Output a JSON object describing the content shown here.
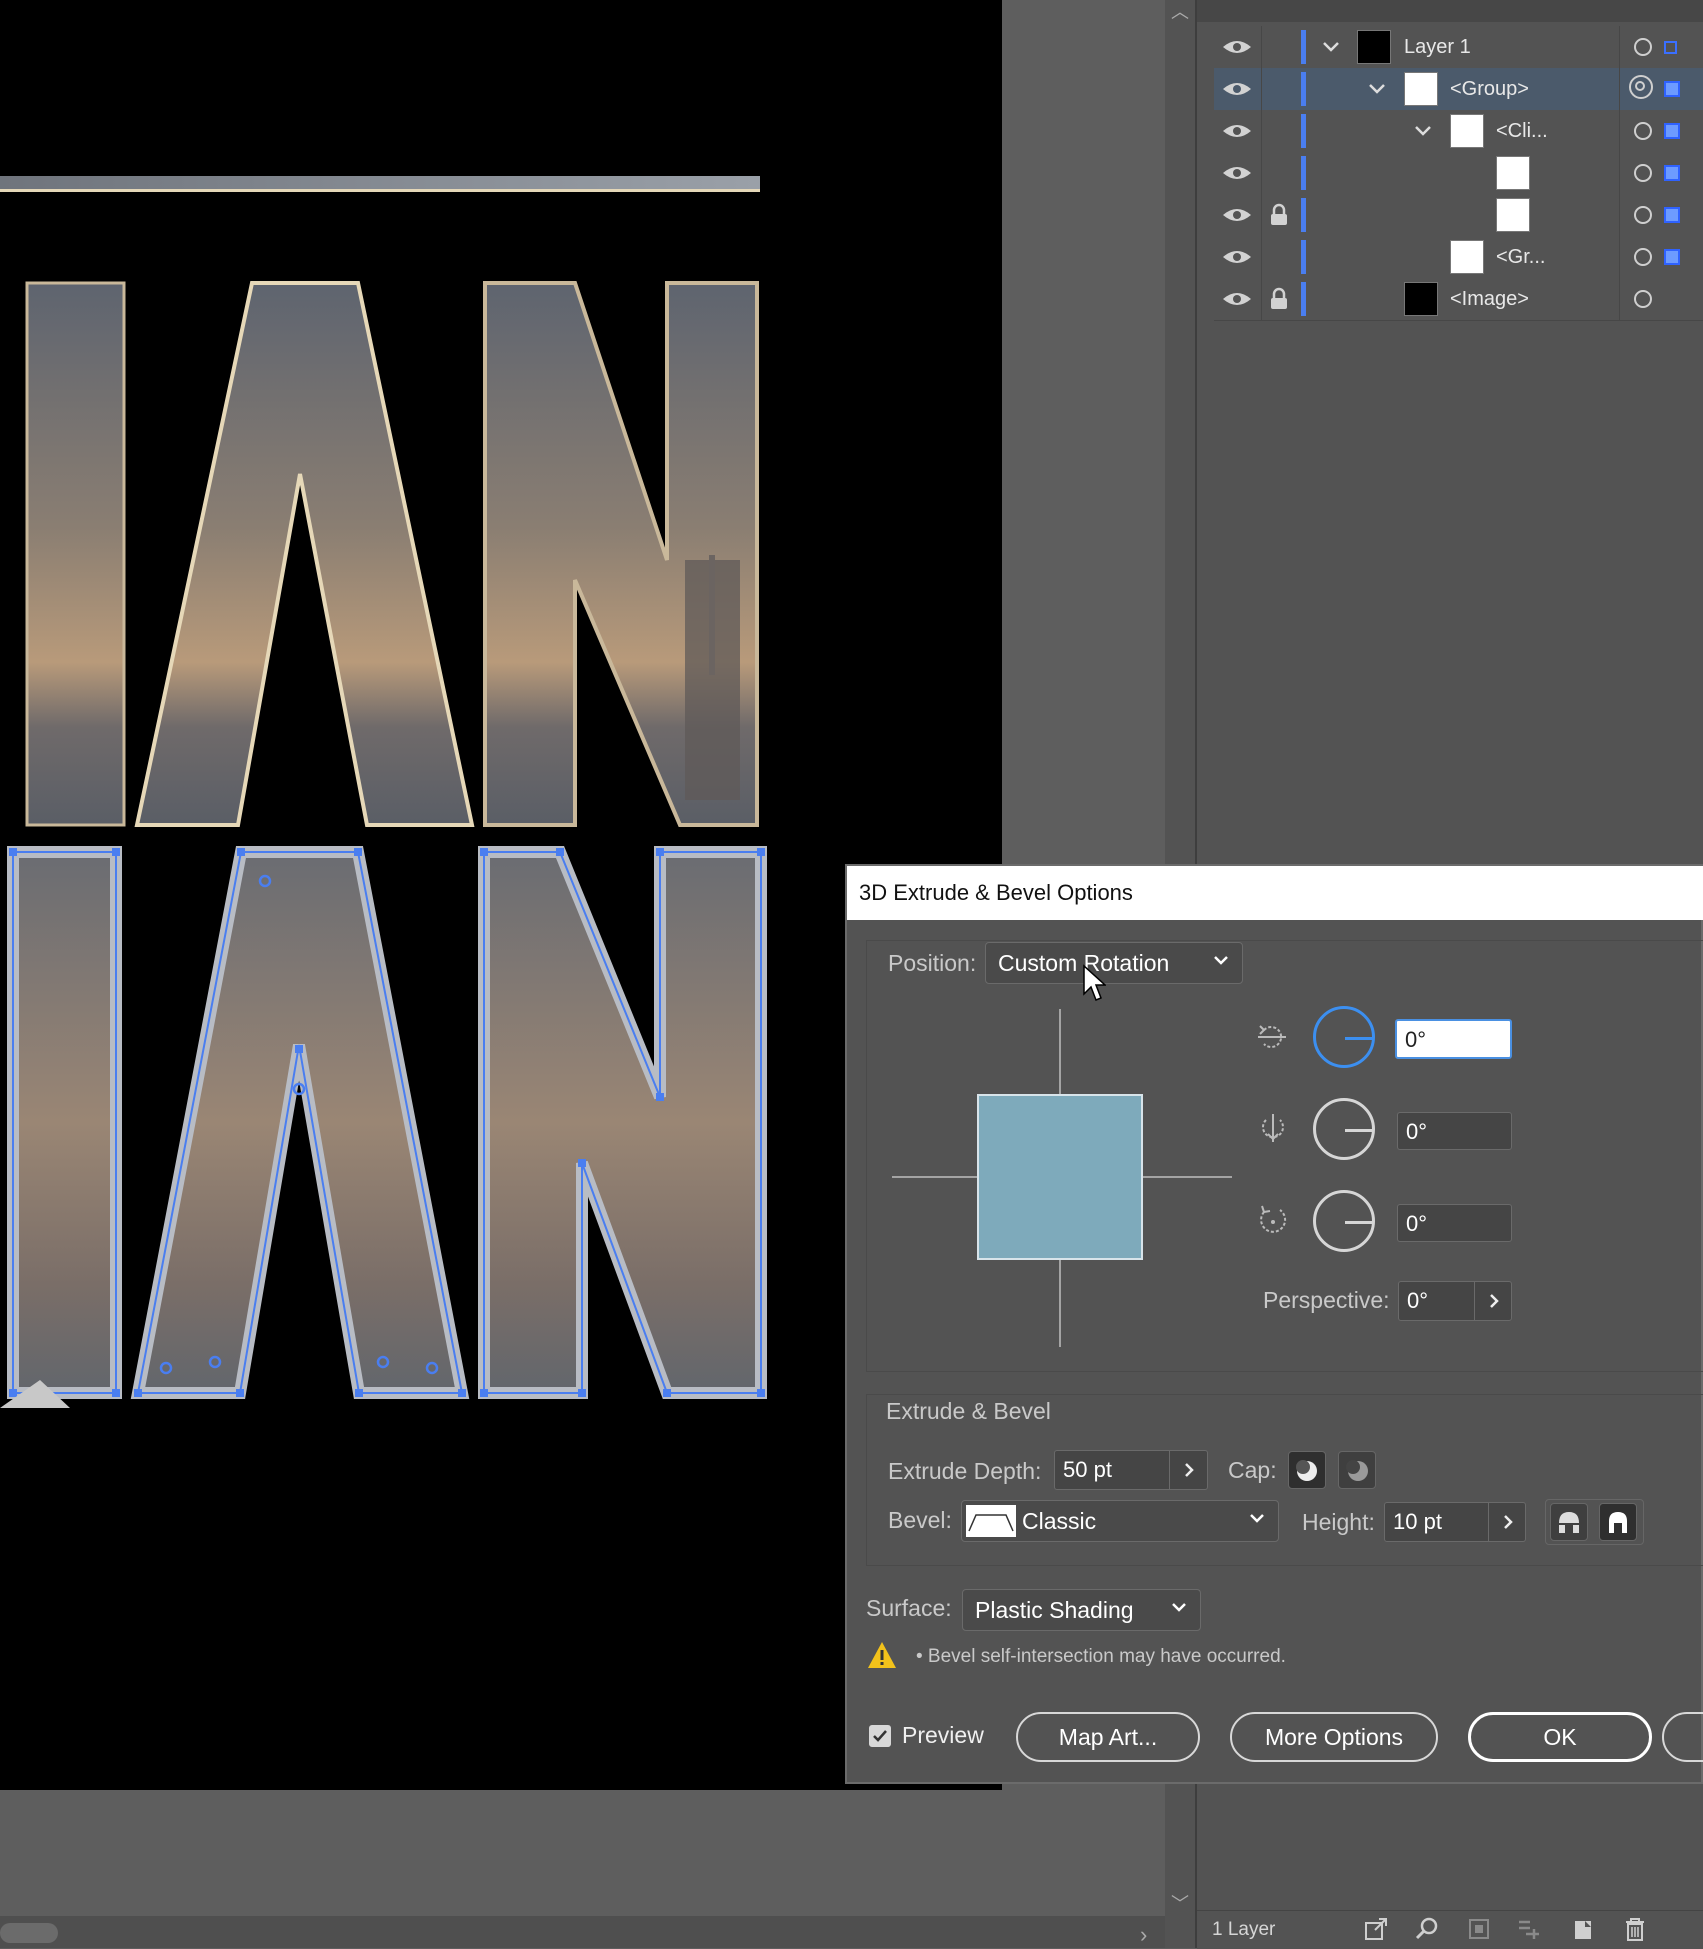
{
  "layers_panel": {
    "rows": [
      {
        "name": "Layer 1",
        "locked": false
      },
      {
        "name": "<Group>",
        "locked": false,
        "selected": true
      },
      {
        "name": "<Cli...",
        "locked": false
      },
      {
        "name": "",
        "locked": false
      },
      {
        "name": "",
        "locked": true
      },
      {
        "name": "<Gr...",
        "locked": false
      },
      {
        "name": "<Image>",
        "locked": true
      }
    ],
    "footer": {
      "layer_count": "1 Layer"
    }
  },
  "dialog": {
    "title": "3D Extrude & Bevel Options",
    "position": {
      "label": "Position:",
      "value": "Custom Rotation"
    },
    "rotation": {
      "x": "0°",
      "y": "0°",
      "z": "0°"
    },
    "perspective": {
      "label": "Perspective:",
      "value": "0°"
    },
    "extrude_bevel": {
      "heading": "Extrude & Bevel",
      "depth_label": "Extrude Depth:",
      "depth_value": "50 pt",
      "cap_label": "Cap:",
      "bevel_label": "Bevel:",
      "bevel_value": "Classic",
      "height_label": "Height:",
      "height_value": "10 pt"
    },
    "surface": {
      "label": "Surface:",
      "value": "Plastic Shading"
    },
    "warning": "• Bevel self-intersection may have occurred.",
    "preview": {
      "label": "Preview",
      "checked": true
    },
    "buttons": {
      "map_art": "Map Art...",
      "more_options": "More Options",
      "ok": "OK"
    }
  },
  "colors": {
    "selection": "#4a7ef0",
    "cube_face": "#7eaabb",
    "dialog_bg": "#535353"
  }
}
